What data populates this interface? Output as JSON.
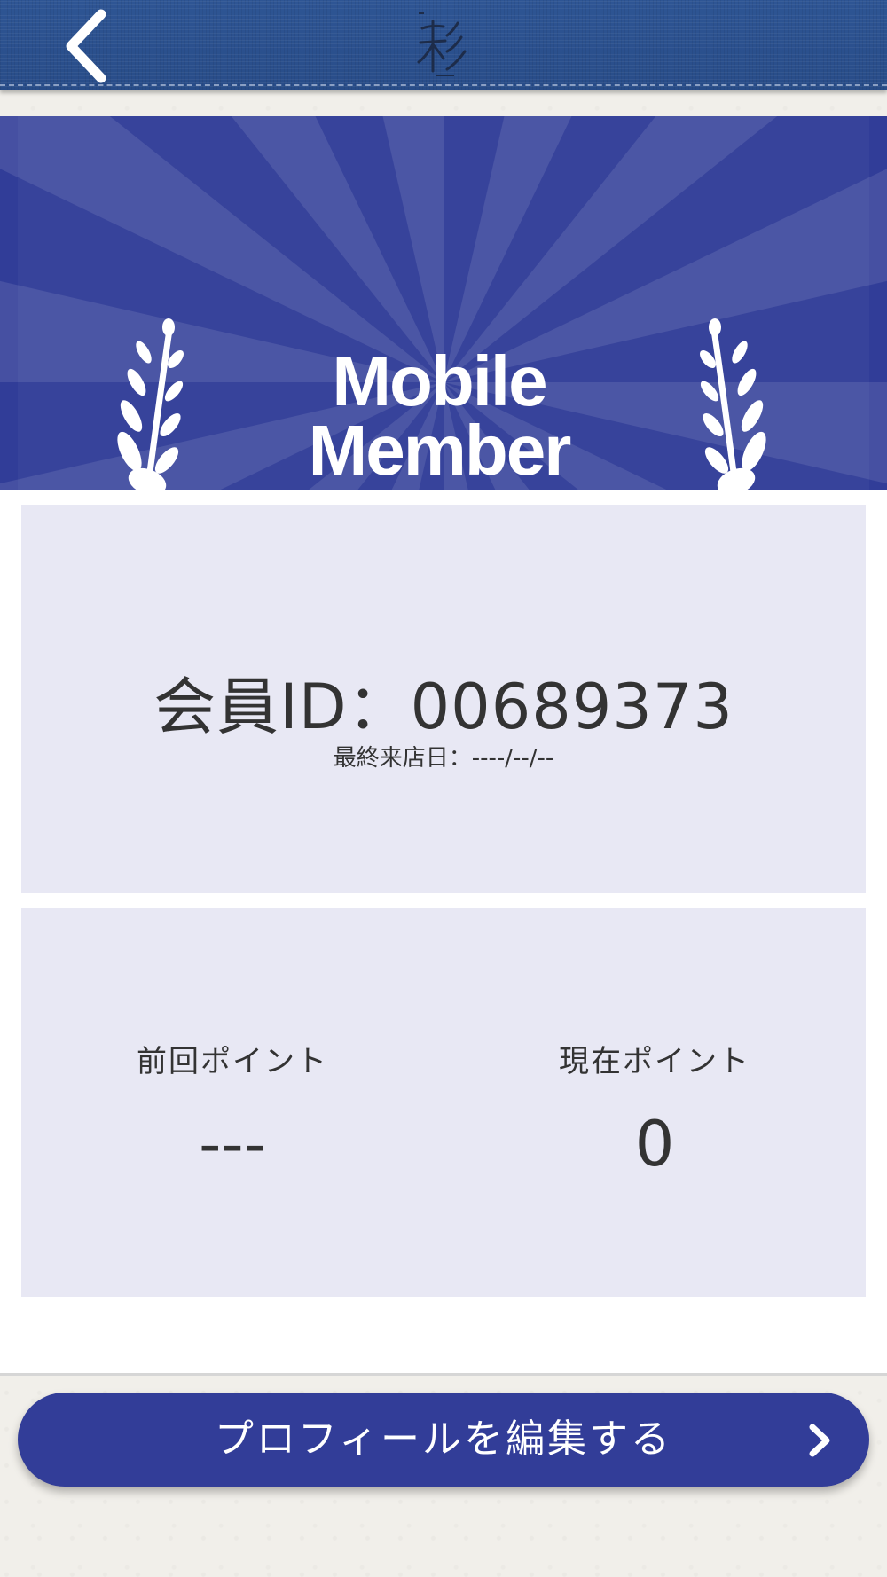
{
  "header": {
    "back_icon": "chevron-left-icon",
    "logo_icon": "sai-logo-icon"
  },
  "banner": {
    "title_line1": "Mobile",
    "title_line2": "Member",
    "left_icon": "laurel-branch-icon",
    "right_icon": "laurel-branch-icon"
  },
  "member": {
    "id_text": "会員ID：00689373",
    "last_visit_text": "最終来店日：----/--/--"
  },
  "points": {
    "previous_label": "前回ポイント",
    "previous_value": "---",
    "current_label": "現在ポイント",
    "current_value": "0"
  },
  "footer": {
    "edit_profile_label": "プロフィールを編集する",
    "chevron_icon": "chevron-right-icon"
  },
  "colors": {
    "header_blue": "#2b5190",
    "banner_blue": "#313d98",
    "card_background": "#e8e8f4",
    "button_blue": "#323d98",
    "text_dark": "#333333"
  }
}
